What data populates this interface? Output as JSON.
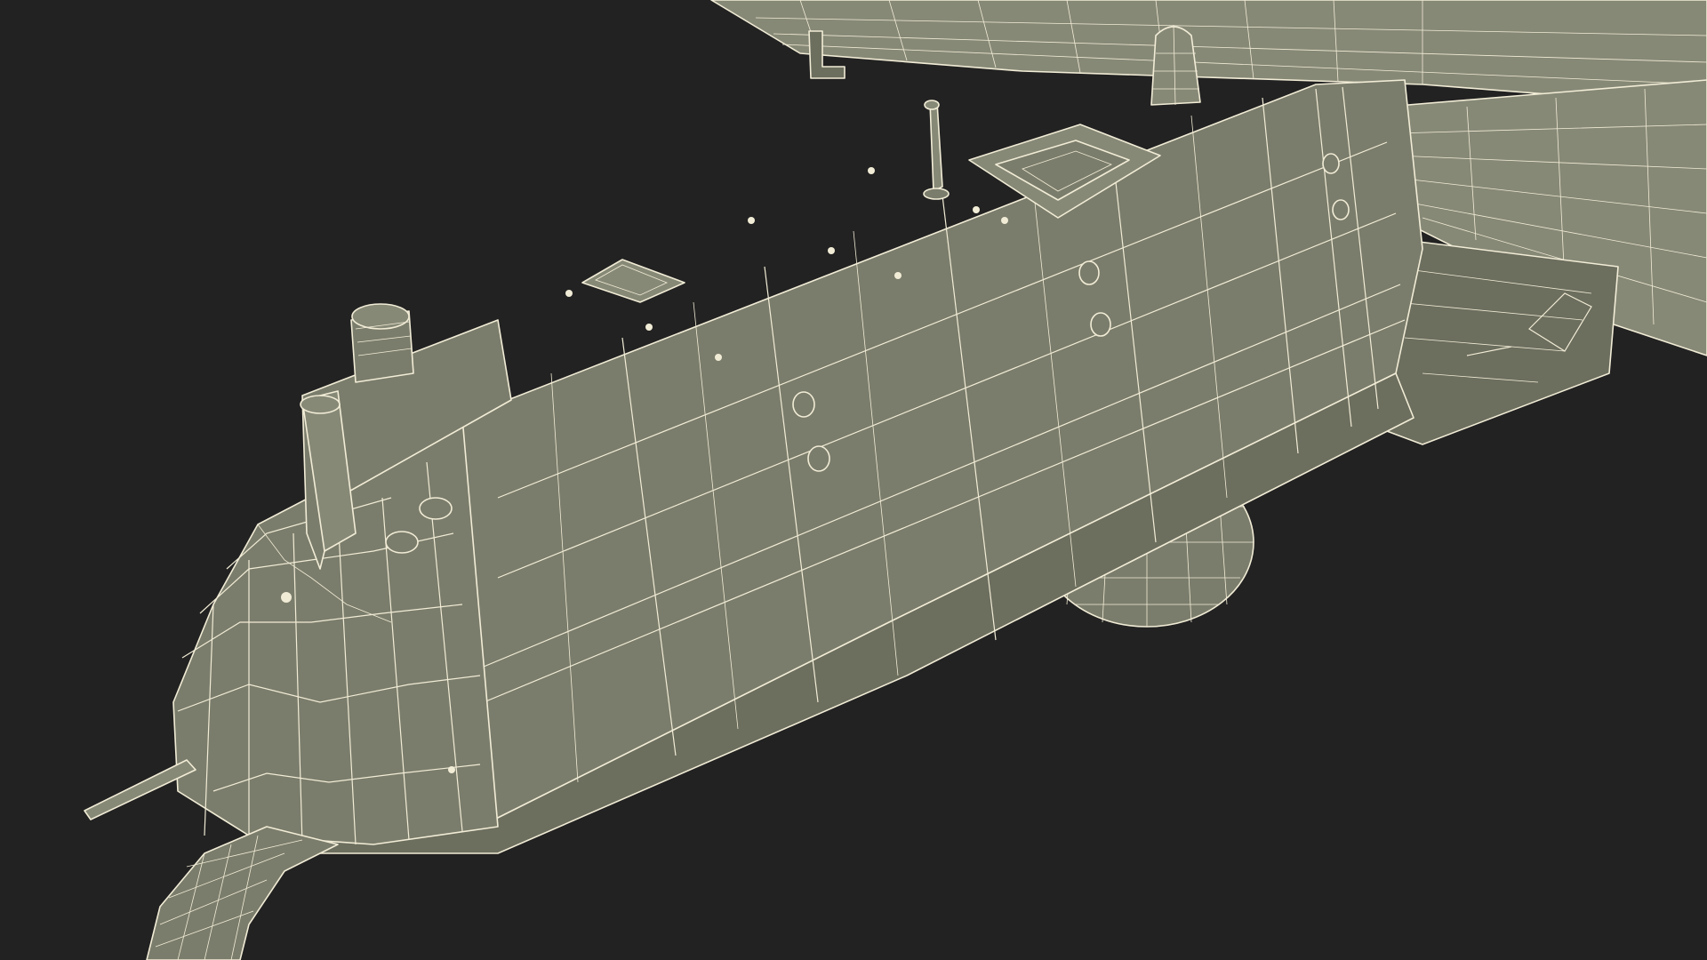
{
  "scene": {
    "background_color": "#222222",
    "surface_color": "#7b7d6c",
    "wireframe_color": "#f1ecd6",
    "objects": [
      {
        "id": "fuselage",
        "name": "fuselage-body"
      },
      {
        "id": "nose",
        "name": "nose-cone"
      },
      {
        "id": "wing_left_upper",
        "name": "wing-upper"
      },
      {
        "id": "wing_right",
        "name": "wing-right"
      },
      {
        "id": "dome",
        "name": "sensor-dome"
      },
      {
        "id": "probe",
        "name": "nose-probe"
      },
      {
        "id": "antenna",
        "name": "antenna-mast"
      },
      {
        "id": "hatch",
        "name": "top-hatch"
      },
      {
        "id": "beacon",
        "name": "beacon-light"
      },
      {
        "id": "exhaust",
        "name": "cylinder-exhaust"
      },
      {
        "id": "skid",
        "name": "landing-skid"
      }
    ]
  }
}
